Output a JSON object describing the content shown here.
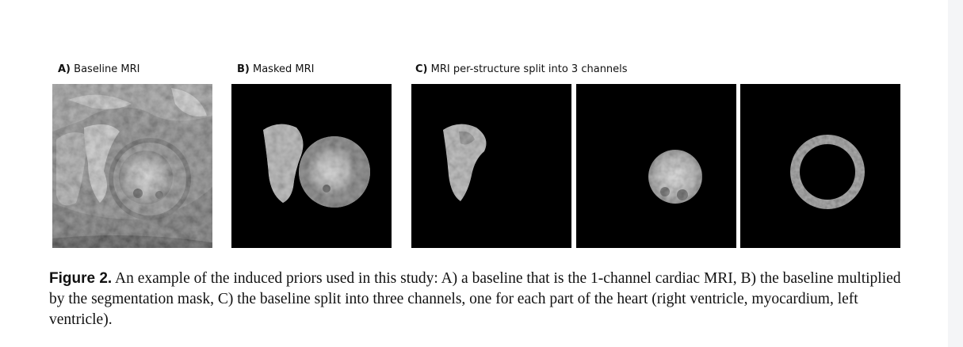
{
  "panels": {
    "a": {
      "letter": "A)",
      "title": "Baseline MRI"
    },
    "b": {
      "letter": "B)",
      "title": "Masked MRI"
    },
    "c": {
      "letter": "C)",
      "title": "MRI per-structure split into 3 channels"
    }
  },
  "caption": {
    "figure_label": "Figure 2.",
    "text": "An example of the induced priors used in this study: A) a baseline that is the 1-channel cardiac MRI, B) the baseline multiplied by the segmentation mask, C) the baseline split into three channels, one for each part of the heart (right ventricle, myocardium, left ventricle)."
  },
  "colors": {
    "background": "#ffffff",
    "image_background": "#000000",
    "text": "#111111"
  }
}
